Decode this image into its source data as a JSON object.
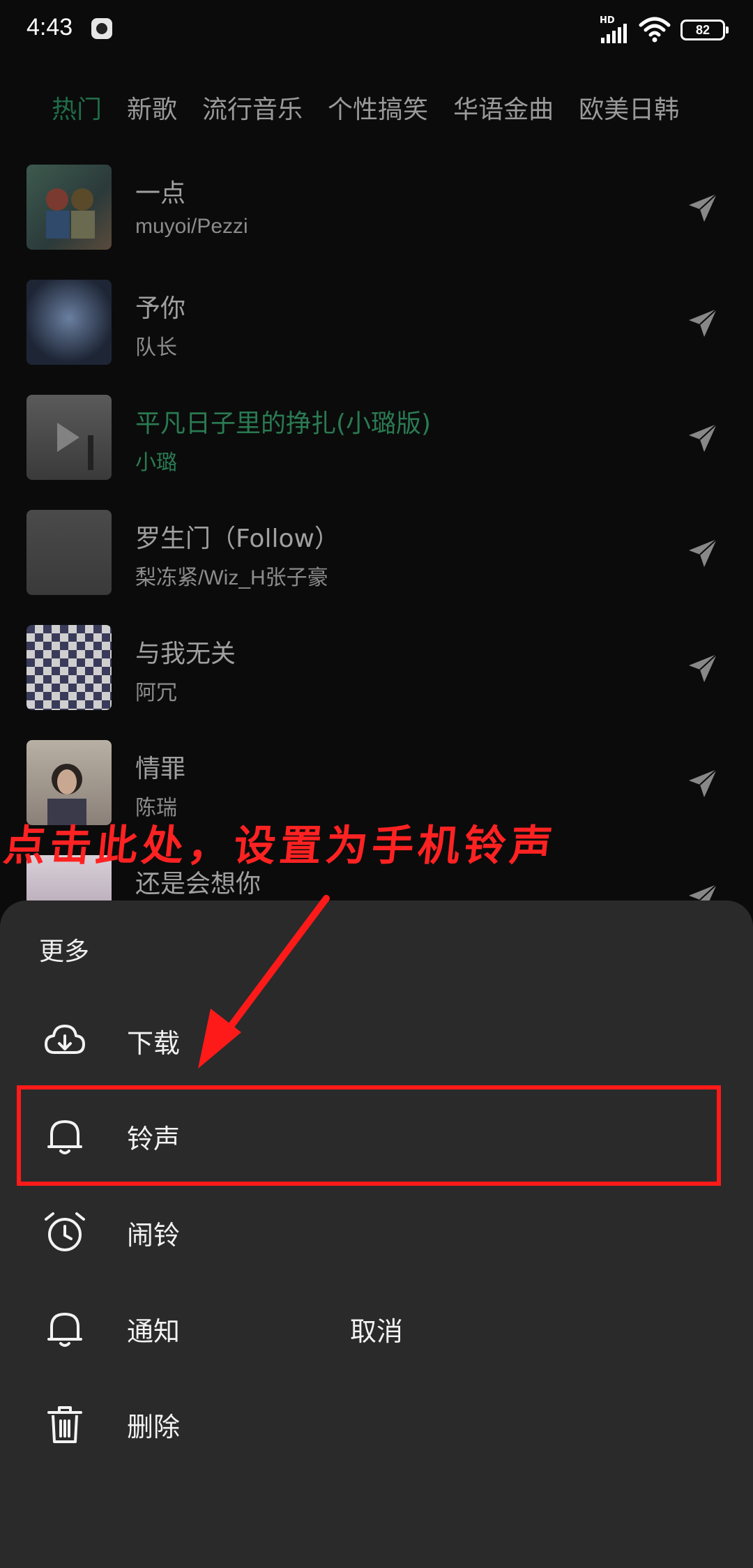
{
  "status_bar": {
    "time": "4:43",
    "network_label": "HD",
    "battery": "82"
  },
  "tabs": [
    {
      "label": "热门",
      "active": true
    },
    {
      "label": "新歌",
      "active": false
    },
    {
      "label": "流行音乐",
      "active": false
    },
    {
      "label": "个性搞笑",
      "active": false
    },
    {
      "label": "华语金曲",
      "active": false
    },
    {
      "label": "欧美日韩",
      "active": false
    }
  ],
  "songs": [
    {
      "title": "一点",
      "artist": "muyoi/Pezzi",
      "playing": false
    },
    {
      "title": "予你",
      "artist": "队长",
      "playing": false
    },
    {
      "title": "平凡日子里的挣扎(小璐版)",
      "artist": "小璐",
      "playing": true
    },
    {
      "title": "罗生门（Follow）",
      "artist": "梨冻紧/Wiz_H张子豪",
      "playing": false
    },
    {
      "title": "与我无关",
      "artist": "阿冗",
      "playing": false
    },
    {
      "title": "情罪",
      "artist": "陈瑞",
      "playing": false
    },
    {
      "title": "还是会想你",
      "artist": "",
      "playing": false
    }
  ],
  "annotation": {
    "text": "点击此处，设置为手机铃声",
    "color": "#ff2222"
  },
  "sheet": {
    "title": "更多",
    "items": [
      {
        "label": "下载",
        "icon": "download-cloud-icon"
      },
      {
        "label": "铃声",
        "icon": "bell-icon",
        "highlighted": true
      },
      {
        "label": "闹铃",
        "icon": "alarm-clock-icon"
      },
      {
        "label": "通知",
        "icon": "notification-bell-icon"
      },
      {
        "label": "删除",
        "icon": "trash-icon"
      }
    ],
    "cancel_label": "取消"
  },
  "colors": {
    "accent": "#2a7a52",
    "background": "#0b0b0b",
    "sheet": "#2a2a2a",
    "highlight": "#ff1a1a"
  }
}
